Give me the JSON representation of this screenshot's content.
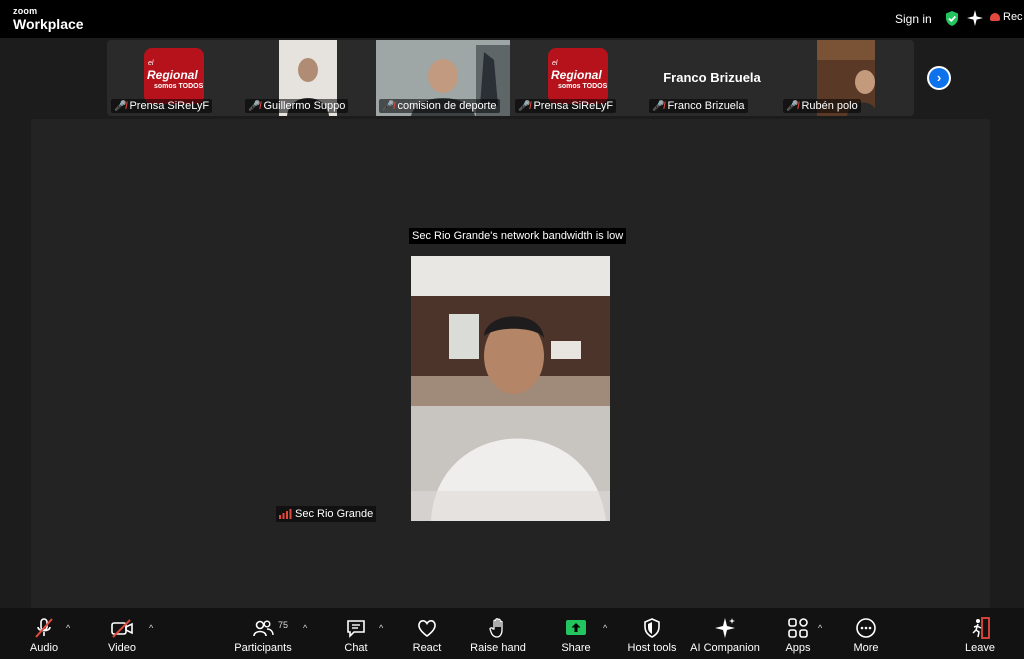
{
  "app": {
    "brand_small": "zoom",
    "brand_big": "Workplace"
  },
  "header": {
    "sign_in": "Sign in",
    "recording_label": "Rec"
  },
  "gallery": {
    "tiles": [
      {
        "name": "Prensa SiReLyF",
        "kind": "logo",
        "logo_top": "el",
        "logo_main": "Regional",
        "logo_sub": "somos TODOS"
      },
      {
        "name": "Guillermo Suppo",
        "kind": "video"
      },
      {
        "name": "comision de deporte",
        "kind": "video"
      },
      {
        "name": "Prensa SiReLyF",
        "kind": "logo",
        "logo_top": "el",
        "logo_main": "Regional",
        "logo_sub": "somos TODOS"
      },
      {
        "name": "Franco Brizuela",
        "kind": "name",
        "display": "Franco Brizuela"
      },
      {
        "name": "Rubén polo",
        "kind": "video"
      }
    ]
  },
  "main": {
    "notice": "Sec Rio Grande's network bandwidth is low",
    "speaker": "Sec Rio Grande"
  },
  "toolbar": {
    "audio": "Audio",
    "video": "Video",
    "participants": "Participants",
    "participants_count": "75",
    "chat": "Chat",
    "react": "React",
    "raise_hand": "Raise hand",
    "share": "Share",
    "host_tools": "Host tools",
    "ai_companion": "AI Companion",
    "apps": "Apps",
    "more": "More",
    "leave": "Leave"
  },
  "colors": {
    "accent": "#0e72ed",
    "share_green": "#22c55e",
    "danger": "#e2483d",
    "shield_green": "#22c55e"
  }
}
